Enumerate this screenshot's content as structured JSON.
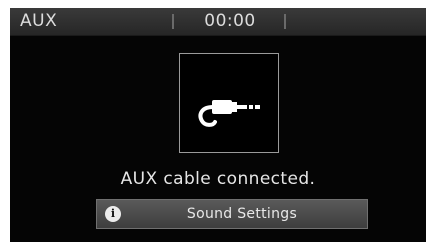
{
  "status_bar": {
    "source": "AUX",
    "time": "00:00"
  },
  "main": {
    "icon": "aux-cable-plug-icon",
    "message": "AUX cable connected."
  },
  "sound_settings_button": {
    "icon": "info-icon",
    "icon_glyph": "i",
    "label": "Sound Settings"
  },
  "colors": {
    "background": "#050505",
    "status_bar": "#2e2e2e",
    "text": "#e6e6e6",
    "button": "#4a4a4a"
  }
}
